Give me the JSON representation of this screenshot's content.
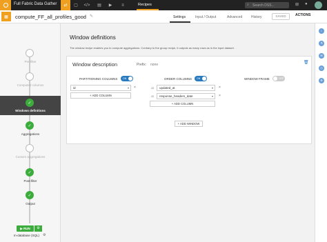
{
  "topbar": {
    "project_name": "Full Fabric Data Gather",
    "recipes_label": "Recipes",
    "search_placeholder": "Search DSS..."
  },
  "header": {
    "recipe_title": "compute_FF_all_profiles_good",
    "tabs": [
      "Settings",
      "Input / Output",
      "Advanced",
      "History"
    ],
    "save_label": "SAVED",
    "actions_label": "ACTIONS"
  },
  "steps": [
    {
      "label": "Pre-filter",
      "state": "empty"
    },
    {
      "label": "Computed columns",
      "state": "empty"
    },
    {
      "label": "Windows definitions",
      "state": "active"
    },
    {
      "label": "Aggregations",
      "state": "done"
    },
    {
      "label": "Custom aggregations",
      "state": "empty"
    },
    {
      "label": "Post-filter",
      "state": "done"
    },
    {
      "label": "Output",
      "state": "done"
    }
  ],
  "run": {
    "run_label": "RUN",
    "engine_label": "In-database (SQL)"
  },
  "main": {
    "title": "Window definitions",
    "description": "The window recipe enables you to compute aggregations. Contrary to the group recipe, it outputs as many rows as in the input dataset."
  },
  "window": {
    "title": "Window description",
    "prefix_label": "Prefix:",
    "prefix_value": "none",
    "partitioning_label": "PARTITIONING COLUMNS",
    "partitioning_toggle": "ON",
    "partition_columns": [
      "id"
    ],
    "order_label": "ORDER COLUMNS",
    "order_toggle": "ON",
    "order_columns": [
      "updated_at",
      "response_headers_date"
    ],
    "frame_label": "WINDOW FRAME",
    "frame_toggle": "OFF",
    "add_column_label": "+ ADD COLUMN",
    "add_window_label": "+ ADD WINDOW"
  },
  "colors": {
    "accent": "#f0a020",
    "success": "#3cad3c",
    "toggle_on": "#2a7ac0"
  }
}
